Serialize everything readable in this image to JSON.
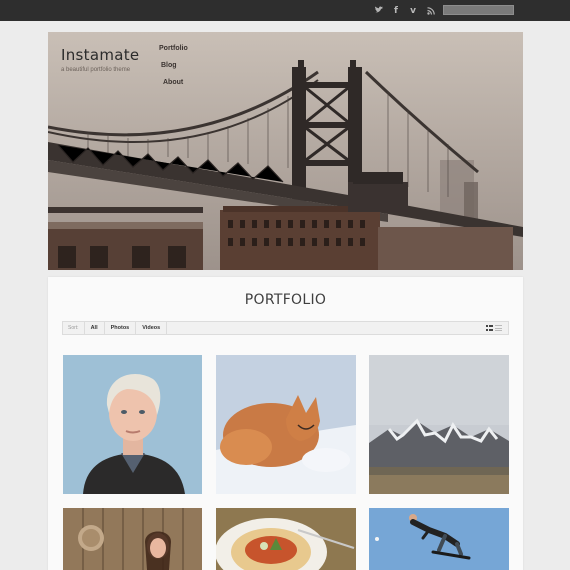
{
  "site": {
    "title": "Instamate",
    "tagline": "a beautiful portfolio theme"
  },
  "nav": {
    "items": [
      "Portfolio",
      "Blog",
      "About"
    ]
  },
  "social_icons": [
    "twitter-icon",
    "facebook-icon",
    "vimeo-icon",
    "rss-icon"
  ],
  "search": {
    "placeholder": ""
  },
  "page": {
    "title": "PORTFOLIO"
  },
  "filters": {
    "sort_label": "Sort:",
    "items": [
      "All",
      "Photos",
      "Videos"
    ],
    "views": [
      "grid-view",
      "list-view"
    ]
  },
  "portfolio_items": [
    {
      "subject": "woman-portrait"
    },
    {
      "subject": "sleeping-fox"
    },
    {
      "subject": "snowy-mountains"
    },
    {
      "subject": "girl-wooden-wall"
    },
    {
      "subject": "pasta-plate"
    },
    {
      "subject": "skateboarder"
    }
  ],
  "colors": {
    "topbar": "#2e2e2e",
    "page_background": "#ececec",
    "panel_background": "#fafafa",
    "title_text": "#3f3f3f"
  }
}
